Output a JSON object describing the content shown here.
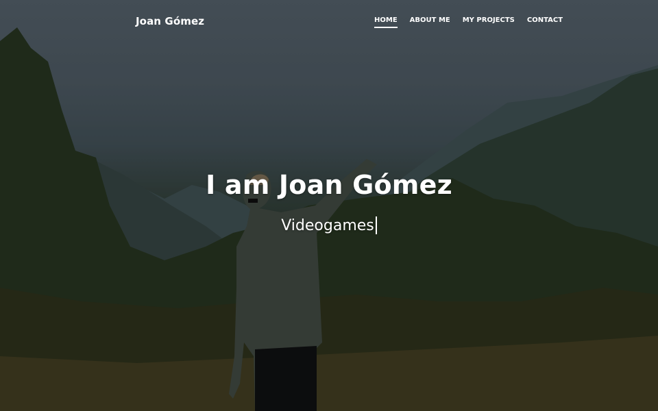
{
  "navbar": {
    "brand": "Joan Gómez",
    "links": [
      {
        "label": "HOME",
        "active": true
      },
      {
        "label": "ABOUT ME",
        "active": false
      },
      {
        "label": "MY PROJECTS",
        "active": false
      },
      {
        "label": "CONTACT",
        "active": false
      }
    ]
  },
  "hero": {
    "title": "I am Joan Gómez",
    "typed_text": "Videogames"
  },
  "colors": {
    "text": "#ffffff",
    "overlay": "rgba(0,0,0,0.28)"
  }
}
